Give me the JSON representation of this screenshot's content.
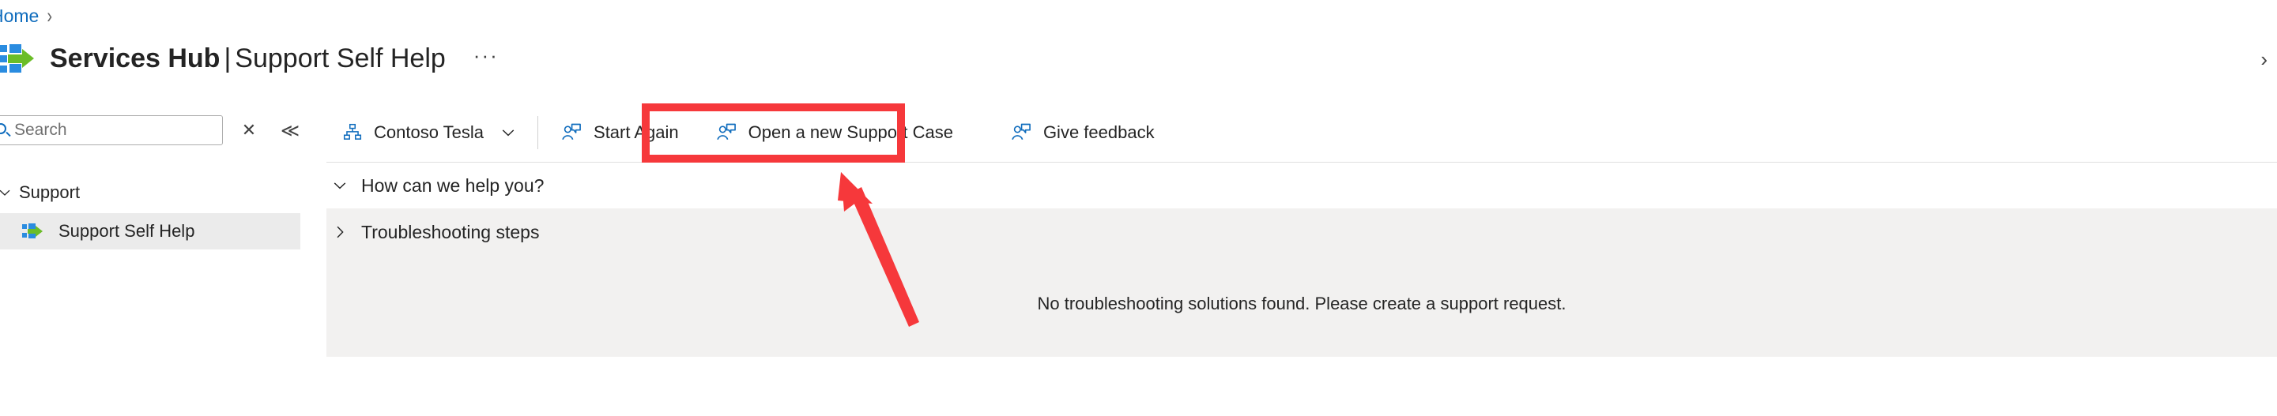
{
  "breadcrumb": {
    "items": [
      {
        "label": "Home",
        "separator": "›"
      }
    ]
  },
  "header": {
    "logo_icon": "services-hub-logo",
    "title_bold": "Services Hub",
    "title_separator": "|",
    "title_regular": "Support Self Help",
    "more_label": "···",
    "right_chevron": "›"
  },
  "sidebar": {
    "search": {
      "placeholder": "Search",
      "value": "",
      "icon": "search-icon",
      "clear_label": "✕",
      "collapse_label": "≪"
    },
    "group": {
      "label": "Support",
      "chevron": "∨"
    },
    "items": [
      {
        "label": "Support Self Help",
        "icon": "services-hub-logo",
        "selected": true
      }
    ]
  },
  "command_bar": {
    "buttons": [
      {
        "label": "Contoso Tesla",
        "icon": "org-hierarchy-icon",
        "has_chevron": true,
        "chevron": "∨"
      },
      {
        "label": "Start Again",
        "icon": "user-message-icon",
        "has_chevron": false
      },
      {
        "label": "Open a new Support Case",
        "icon": "user-message-icon",
        "has_chevron": false,
        "highlighted": true
      },
      {
        "label": "Give feedback",
        "icon": "user-message-icon",
        "has_chevron": false
      }
    ]
  },
  "main": {
    "sections": [
      {
        "label": "How can we help you?",
        "expanded": true,
        "chevron": "∨"
      },
      {
        "label": "Troubleshooting steps",
        "expanded": false,
        "chevron": "›"
      }
    ],
    "empty_message": "No troubleshooting solutions found. Please create a support request."
  },
  "annotations": {
    "highlight_color": "#f6383b",
    "arrow_color": "#f6383b",
    "highlight_target": "Open a new Support Case",
    "arrow_points_to": "Open a new Support Case"
  },
  "colors": {
    "accent": "#0f6cbd",
    "link": "#0f6cbd",
    "logo_blue": "#2a8ce0",
    "logo_green": "#6bbd28",
    "panel_gray": "#f2f1f0",
    "selected_gray": "#ebebeb",
    "text": "#242424"
  }
}
